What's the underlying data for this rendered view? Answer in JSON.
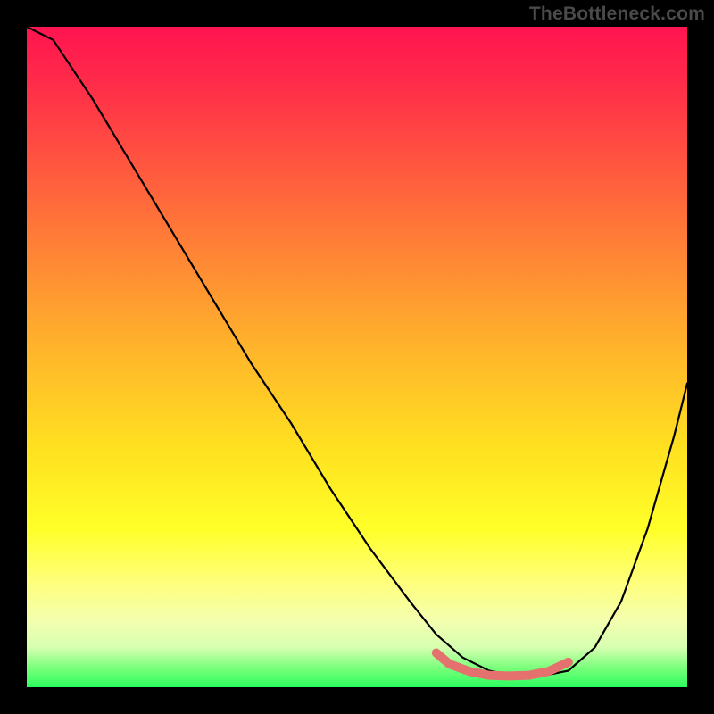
{
  "watermark": "TheBottleneck.com",
  "colors": {
    "background": "#000000",
    "curve": "#000000",
    "marker": "#e4716e",
    "gradient_top": "#ff1450",
    "gradient_bottom": "#2bff60"
  },
  "chart_data": {
    "type": "line",
    "title": "",
    "xlabel": "",
    "ylabel": "",
    "xlim": [
      0,
      100
    ],
    "ylim": [
      0,
      100
    ],
    "grid": false,
    "note": "Values estimated from pixel positions; y is measured from top (0) to bottom (100).",
    "series": [
      {
        "name": "bottleneck-curve",
        "x": [
          0,
          4,
          10,
          16,
          22,
          28,
          34,
          40,
          46,
          52,
          58,
          62,
          66,
          70,
          74,
          78,
          82,
          86,
          90,
          94,
          98,
          100
        ],
        "y": [
          0,
          2,
          11,
          21,
          31,
          41,
          51,
          60,
          70,
          79,
          87,
          92,
          95.5,
          97.5,
          98.3,
          98.3,
          97.5,
          94,
          87,
          76,
          62,
          54
        ]
      }
    ],
    "marker_segment": {
      "name": "optimal-range",
      "x": [
        62,
        64,
        67,
        70,
        73,
        76,
        79,
        82
      ],
      "y": [
        94.8,
        96.5,
        97.6,
        98.2,
        98.3,
        98.2,
        97.6,
        96.2
      ],
      "color": "#e4716e",
      "stroke_width": 10
    }
  }
}
